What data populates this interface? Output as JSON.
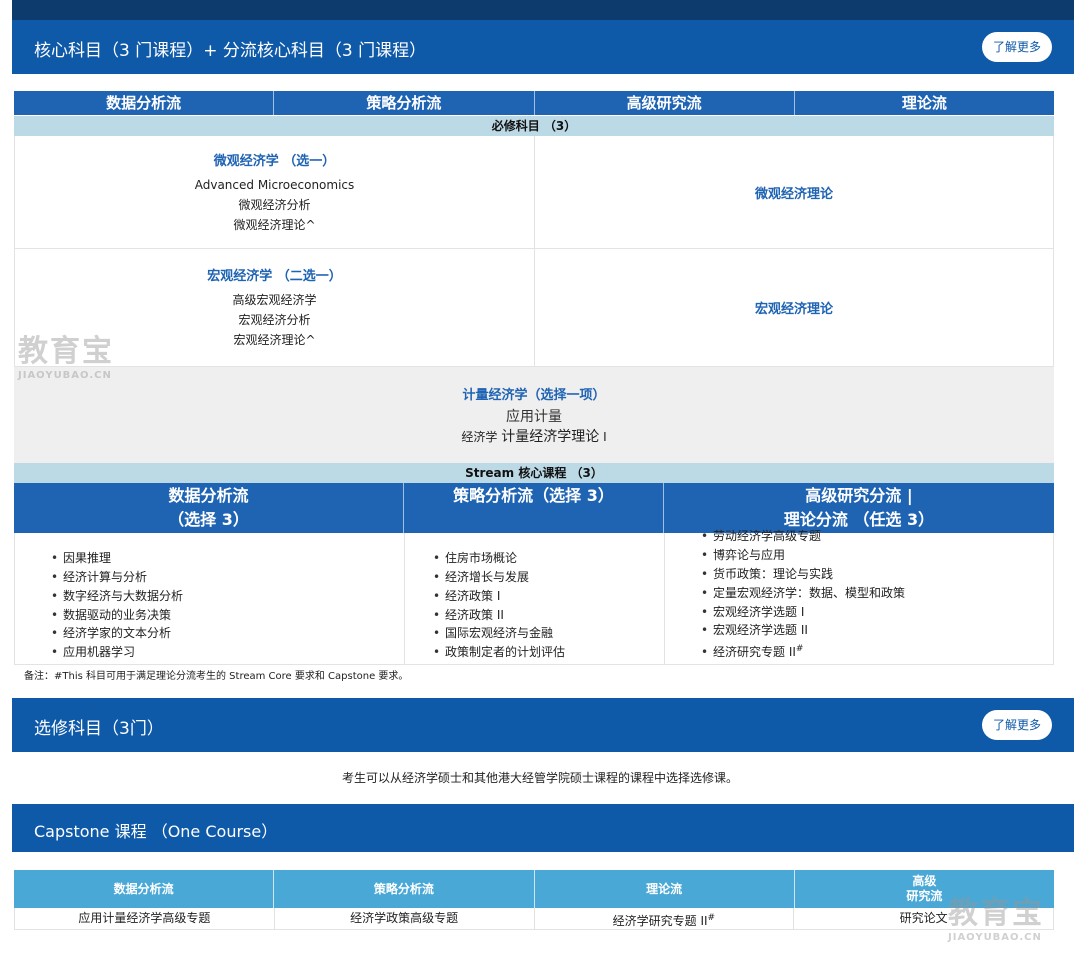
{
  "core_section": {
    "title": "核心科目（3 门课程）+ 分流核心科目（3 门课程）",
    "more_label": "了解更多"
  },
  "streams": [
    "数据分析流",
    "策略分析流",
    "高级研究流",
    "理论流"
  ],
  "required": {
    "label": "必修科目 （3）",
    "micro": {
      "title": "微观经济学 （选一）",
      "options": [
        "Advanced Microeconomics",
        "微观经济分析",
        "微观经济理论^"
      ],
      "right": "微观经济理论"
    },
    "macro": {
      "title": "宏观经济学 （二选一）",
      "options": [
        "高级宏观经济学",
        "宏观经济分析",
        "宏观经济理论^"
      ],
      "right": "宏观经济理论"
    },
    "econometrics": {
      "title": "计量经济学（选择一项）",
      "line2": "应用计量",
      "line3_small": "经济学",
      "line3_big": "计量经济学理论",
      "line3_suffix": "I"
    }
  },
  "stream_core": {
    "label": "Stream 核心课程 （3）",
    "headers": {
      "data": [
        "数据分析流",
        "（选择 3）"
      ],
      "strategy": [
        "策略分析流（选择 3）"
      ],
      "advanced": [
        "高级研究分流 |",
        "理论分流 （任选 3）"
      ]
    },
    "data_courses": [
      "因果推理",
      "经济计算与分析",
      "数字经济与大数据分析",
      "数据驱动的业务决策",
      "经济学家的文本分析",
      "应用机器学习"
    ],
    "strategy_courses": [
      "住房市场概论",
      "经济增长与发展",
      "经济政策 I",
      "经济政策 II",
      "国际宏观经济与金融",
      "政策制定者的计划评估"
    ],
    "advanced_courses": [
      "劳动经济学高级专题",
      "博弈论与应用",
      "货币政策：理论与实践",
      "定量宏观经济学：数据、模型和政策",
      "宏观经济学选题 I",
      "宏观经济学选题 II",
      "经济研究专题 II"
    ],
    "advanced_last_sup": "#"
  },
  "note": "备注：#This 科目可用于满足理论分流考生的 Stream Core 要求和 Capstone 要求。",
  "elective_section": {
    "title": "选修科目（3门）",
    "more_label": "了解更多",
    "text": "考生可以从经济学硕士和其他港大经管学院硕士课程的课程中选择选修课。"
  },
  "capstone_section": {
    "title": "Capstone 课程 （One Course）",
    "headers": [
      "数据分析流",
      "策略分析流",
      "理论流",
      "高级",
      "研究流"
    ],
    "courses": [
      "应用计量经济学高级专题",
      "经济学政策高级专题",
      "经济学研究专题 II",
      "研究论文"
    ],
    "sup": "#"
  },
  "watermark": {
    "main": "教育宝",
    "sub": "JIAOYUBAO.CN"
  }
}
